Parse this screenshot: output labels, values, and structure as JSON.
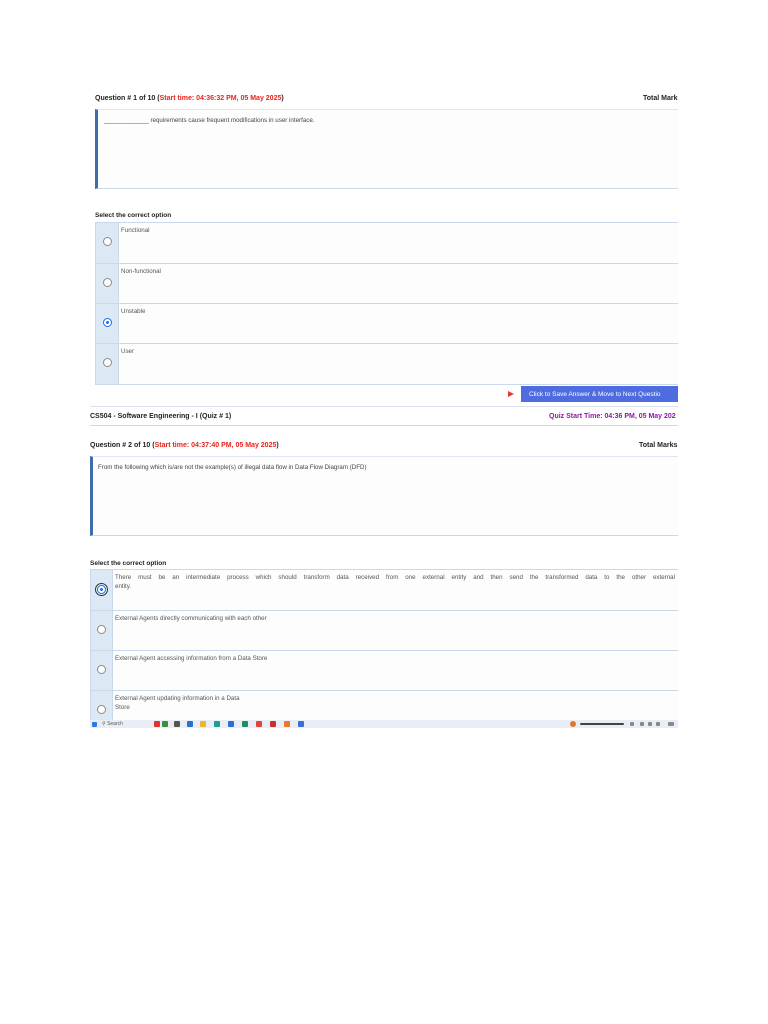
{
  "question1": {
    "header_prefix": "Question # 1 of 10 (",
    "start_time": "Start time: 04:36:32 PM, 05 May 2025",
    "header_suffix": ")",
    "total_marks_label": "Total Mark",
    "text": "_____________ requirements cause frequent modifications in user interface.",
    "select_label": "Select the correct option",
    "options": [
      {
        "label": "Functional",
        "selected": false
      },
      {
        "label": "Non-functional",
        "selected": false
      },
      {
        "label": "Unstable",
        "selected": true
      },
      {
        "label": "User",
        "selected": false
      }
    ],
    "save_button_label": "Click to Save Answer & Move to Next Questio"
  },
  "quiz_bar": {
    "title": "CS504 - Software Engineering - I (Quiz # 1)",
    "start_time": "Quiz Start Time: 04:36 PM, 05 May 202"
  },
  "question2": {
    "header_prefix": "Question # 2 of 10 (",
    "start_time": "Start time: 04:37:40 PM, 05 May 2025",
    "header_suffix": ")",
    "total_marks_label": "Total Marks",
    "text": "From the following which is/are not the example(s) of illegal data flow in Data Flow Diagram (DFD)",
    "select_label": "Select the correct option",
    "options": [
      {
        "label_line1": "There must be an intermediate process which should transform data received from one external entity and then send the transformed data to the other external",
        "label_line2": "entity.",
        "selected": true
      },
      {
        "label_line1": "External Agents directly communicating with each other",
        "label_line2": "",
        "selected": false
      },
      {
        "label_line1": "External Agent accessing information from a Data Store",
        "label_line2": "",
        "selected": false
      },
      {
        "label_line1": "External Agent updating information in a Data",
        "label_line2": "Store",
        "selected": false
      }
    ]
  },
  "taskbar": {
    "search_placeholder": "Search"
  },
  "colors": {
    "accent_red": "#e8231b",
    "button_blue": "#4f6be0",
    "quiz_purple": "#8b1aa6",
    "selected_radio": "#1a6fe6"
  },
  "icons": [
    "windows-start-icon",
    "search-icon",
    "play-arrow-icon",
    "radio-icon"
  ]
}
